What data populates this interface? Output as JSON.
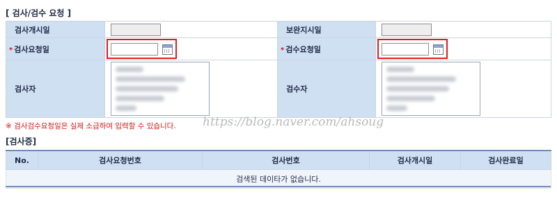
{
  "request_section": {
    "title": "[ 검사/검수 요청 ]",
    "rows": {
      "inspect_start_label": "검사개시일",
      "supplement_label": "보완지시일",
      "inspect_request_label": "검사요청일",
      "acceptance_request_label": "검수요청일",
      "inspector_label": "검사자",
      "acceptor_label": "검수자"
    },
    "required_mark": "*",
    "notice": "※ 검사검수요청일은 실제 소급하여 입력할 수 있습니다."
  },
  "watermark": "https://blog.naver.com/ahsoug",
  "certificate_section": {
    "title": "[검사증]",
    "columns": [
      "No.",
      "검사요청번호",
      "검사번호",
      "검사개시일",
      "검사완료일"
    ],
    "empty_message": "검색된 데이타가 없습니다."
  },
  "colors": {
    "header_bg": "#d0e0f3",
    "required": "#d01818",
    "highlight_border": "#e01c1c",
    "grid_line": "#6f8ab5"
  }
}
